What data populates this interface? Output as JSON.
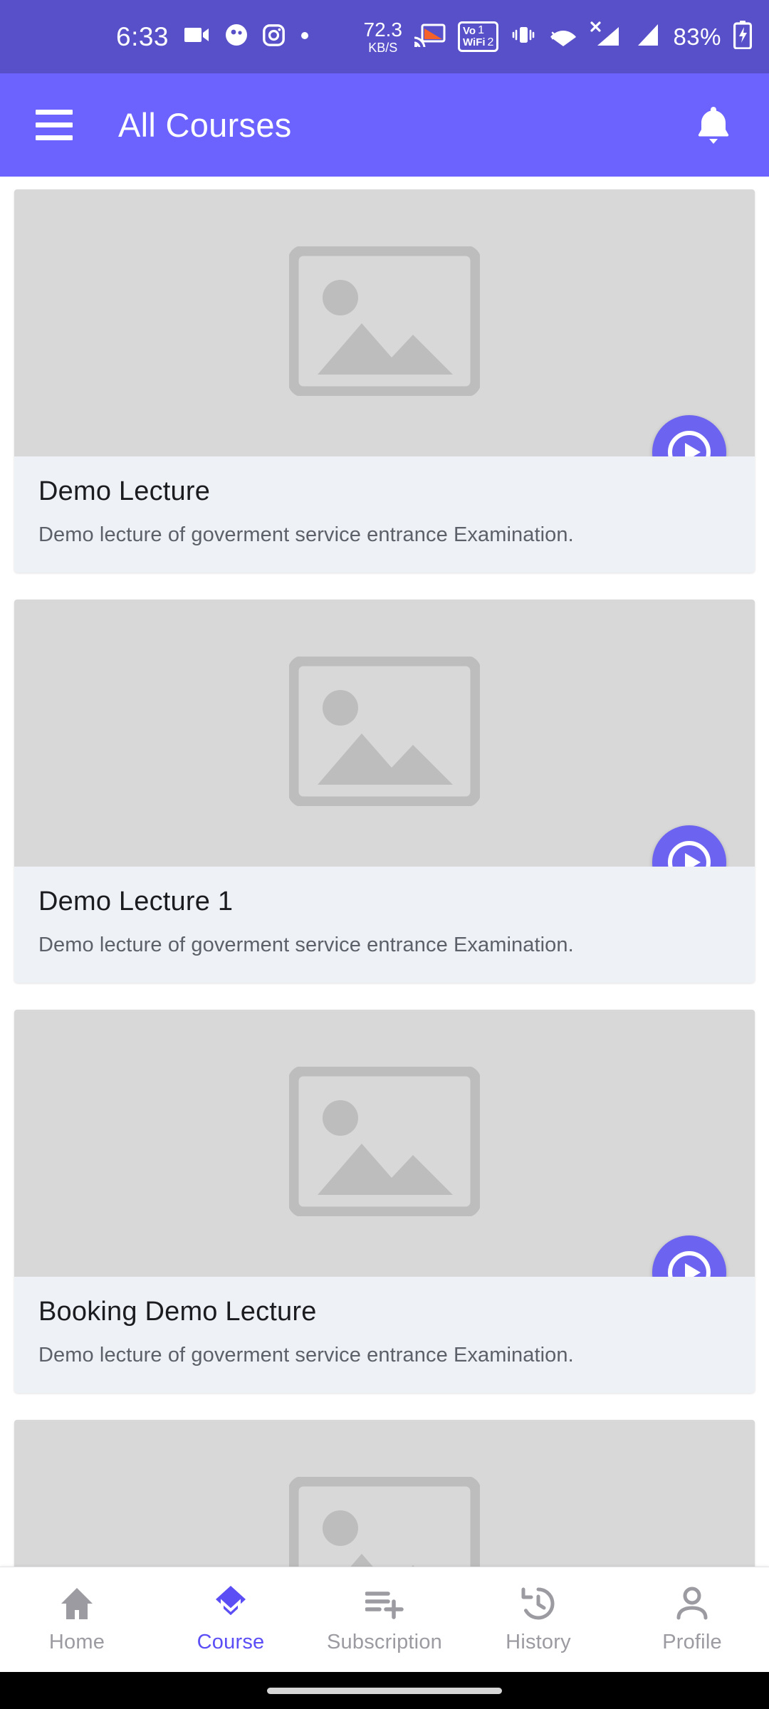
{
  "status_bar": {
    "time": "6:33",
    "icons_left": [
      "video-camera-icon",
      "contacts-icon",
      "instagram-icon",
      "dot-icon"
    ],
    "network_speed_value": "72.3",
    "network_speed_unit": "KB/S",
    "cast_icon": "screen-cast-icon",
    "vowifi_label_top": "Vo",
    "vowifi_label_bottom": "WiFi",
    "vowifi_sim1": "1",
    "vowifi_sim2": "2",
    "vibrate_icon": "vibrate-icon",
    "wifi_icon": "wifi-icon",
    "signal_x_icon": "signal-no-service-icon",
    "signal_icon": "signal-bars-icon",
    "battery_percent": "83%",
    "battery_icon": "battery-charging-icon",
    "background_color": "#5850c8"
  },
  "app_bar": {
    "menu_icon": "hamburger-menu-icon",
    "title": "All Courses",
    "notification_icon": "bell-icon",
    "background_color": "#6c63ff"
  },
  "courses": [
    {
      "title": "Demo Lecture",
      "description": "Demo lecture of goverment service entrance Examination.",
      "thumbnail": "image-placeholder-icon",
      "play_label": "play-icon"
    },
    {
      "title": "Demo Lecture 1",
      "description": "Demo lecture of goverment service entrance Examination.",
      "thumbnail": "image-placeholder-icon",
      "play_label": "play-icon"
    },
    {
      "title": "Booking Demo Lecture",
      "description": "Demo lecture of goverment service entrance Examination.",
      "thumbnail": "image-placeholder-icon",
      "play_label": "play-icon"
    },
    {
      "title": "",
      "description": "",
      "thumbnail": "image-placeholder-icon",
      "play_label": "play-icon"
    }
  ],
  "bottom_nav": {
    "active_color": "#5b4ef5",
    "inactive_color": "#9b9ba1",
    "items": [
      {
        "label": "Home",
        "icon": "home-icon",
        "active": false
      },
      {
        "label": "Course",
        "icon": "graduation-cap-icon",
        "active": true
      },
      {
        "label": "Subscription",
        "icon": "playlist-add-icon",
        "active": false
      },
      {
        "label": "History",
        "icon": "history-clock-icon",
        "active": false
      },
      {
        "label": "Profile",
        "icon": "person-icon",
        "active": false
      }
    ]
  },
  "theme": {
    "primary": "#6c63ff",
    "primary_dark": "#5850c8",
    "accent": "#5b4ef5",
    "card_bg": "#eef1f6",
    "thumb_bg": "#d8d8d8"
  }
}
